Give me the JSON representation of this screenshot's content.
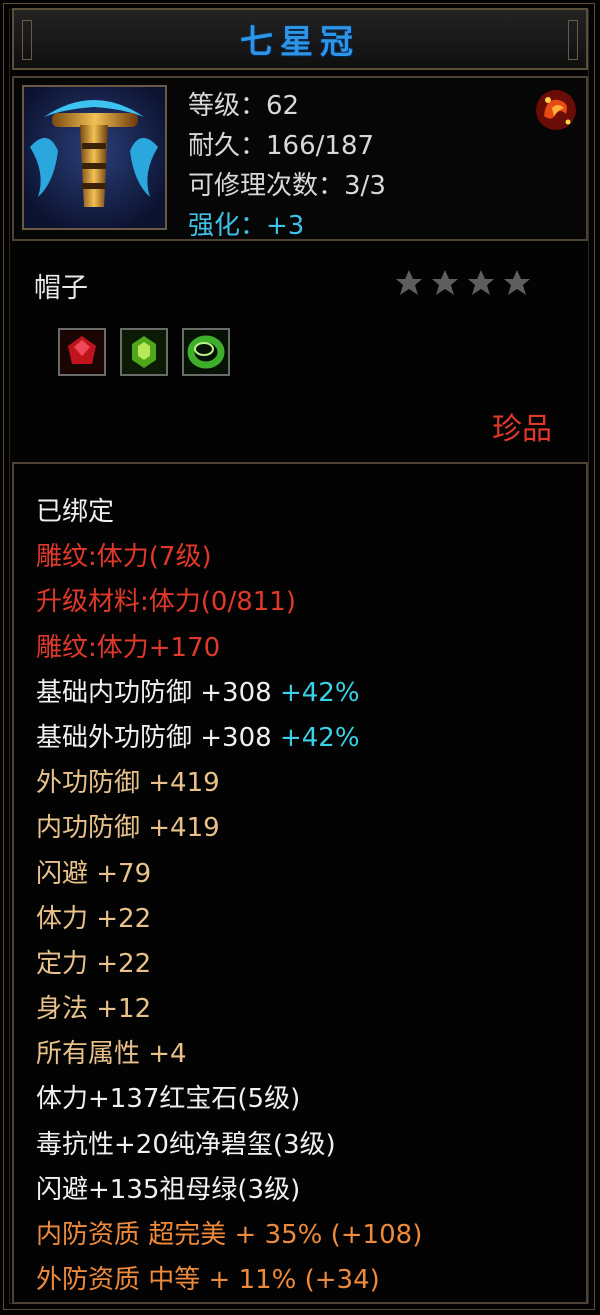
{
  "title": "七星冠",
  "stats": {
    "level_label": "等级：",
    "level": "62",
    "durability_label": "耐久：",
    "durability": "166/187",
    "repair_label": "可修理次数：",
    "repair": "3/3",
    "enhance_label": "强化：",
    "enhance": "+3"
  },
  "item_type": "帽子",
  "stars": {
    "filled": 0,
    "total": 4
  },
  "gems": [
    "red-gem-icon",
    "green-gem-icon",
    "jade-ring-icon"
  ],
  "rarity": "珍品",
  "colors": {
    "title": "#2e94e6",
    "red": "#e0392a",
    "tan": "#e8c18b",
    "orange": "#ee8a3c",
    "cyan": "#3ad0e6"
  },
  "attributes": [
    {
      "text": "已绑定",
      "extra": "",
      "color": "white"
    },
    {
      "text": "雕纹:体力(7级)",
      "extra": "",
      "color": "red"
    },
    {
      "text": "升级材料:体力(0/811)",
      "extra": "",
      "color": "red"
    },
    {
      "text": "雕纹:体力+170",
      "extra": "",
      "color": "red"
    },
    {
      "text": "基础内功防御 +308",
      "extra": "+42%",
      "color": "white"
    },
    {
      "text": "基础外功防御 +308",
      "extra": "+42%",
      "color": "white"
    },
    {
      "text": "外功防御 +419",
      "extra": "",
      "color": "tan"
    },
    {
      "text": "内功防御 +419",
      "extra": "",
      "color": "tan"
    },
    {
      "text": "闪避 +79",
      "extra": "",
      "color": "tan"
    },
    {
      "text": "体力 +22",
      "extra": "",
      "color": "tan"
    },
    {
      "text": "定力 +22",
      "extra": "",
      "color": "tan"
    },
    {
      "text": "身法 +12",
      "extra": "",
      "color": "tan"
    },
    {
      "text": "所有属性 +4",
      "extra": "",
      "color": "tan"
    },
    {
      "text": "体力+137红宝石(5级)",
      "extra": "",
      "color": "white"
    },
    {
      "text": "毒抗性+20纯净碧玺(3级)",
      "extra": "",
      "color": "white"
    },
    {
      "text": "闪避+135祖母绿(3级)",
      "extra": "",
      "color": "white"
    },
    {
      "text": "内防资质 超完美 + 35% (+108)",
      "extra": "",
      "color": "orange"
    },
    {
      "text": "外防资质 中等 + 11% (+34)",
      "extra": "",
      "color": "orange"
    }
  ]
}
